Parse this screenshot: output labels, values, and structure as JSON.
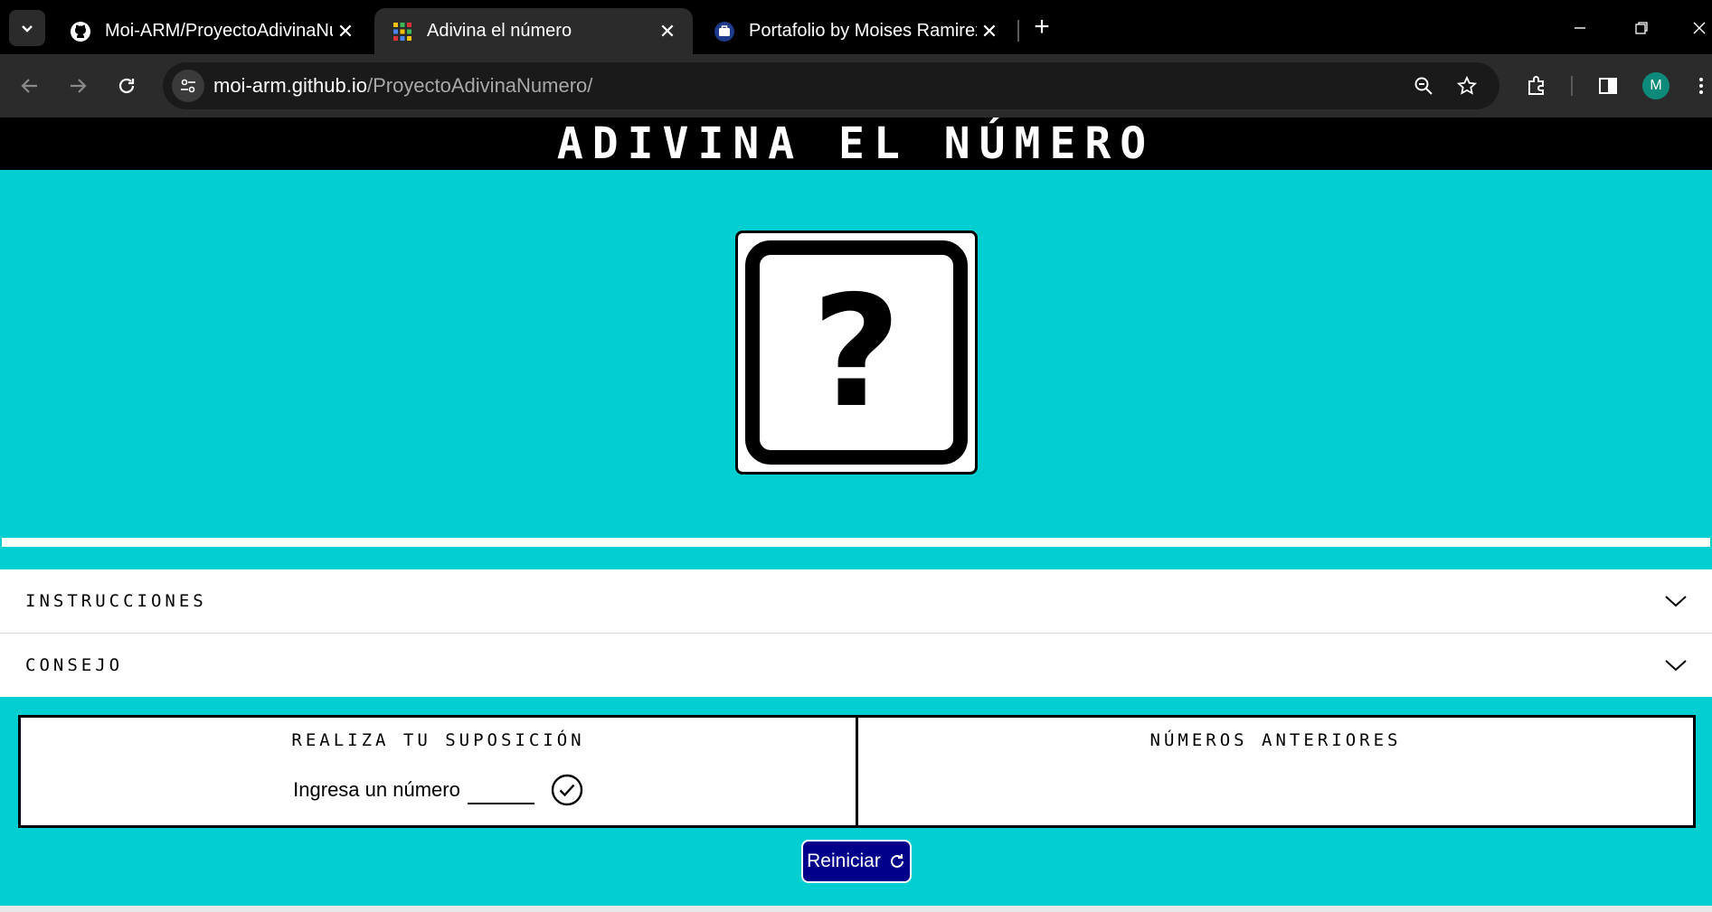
{
  "browser": {
    "tabs": [
      {
        "title": "Moi-ARM/ProyectoAdivinaNumero",
        "favicon": "github-icon",
        "active": false
      },
      {
        "title": "Adivina el número",
        "favicon": "grid-icon",
        "active": true
      },
      {
        "title": "Portafolio by Moises Ramirez",
        "favicon": "briefcase-icon",
        "active": false
      }
    ],
    "address": {
      "host": "moi-arm.github.io",
      "path": "/ProyectoAdivinaNumero/"
    },
    "profile_initial": "M"
  },
  "page": {
    "title": "ADIVINA EL NÚMERO",
    "mystery_symbol": "?",
    "accordion": [
      {
        "label": "INSTRUCCIONES"
      },
      {
        "label": "CONSEJO"
      }
    ],
    "guess_panel": {
      "title": "REALIZA TU SUPOSICIÓN",
      "input_label": "Ingresa un número",
      "input_value": ""
    },
    "history_panel": {
      "title": "NÚMEROS ANTERIORES"
    },
    "restart_label": "Reiniciar"
  },
  "colors": {
    "background": "#00CED1",
    "header": "#000000",
    "button": "#00008B"
  }
}
